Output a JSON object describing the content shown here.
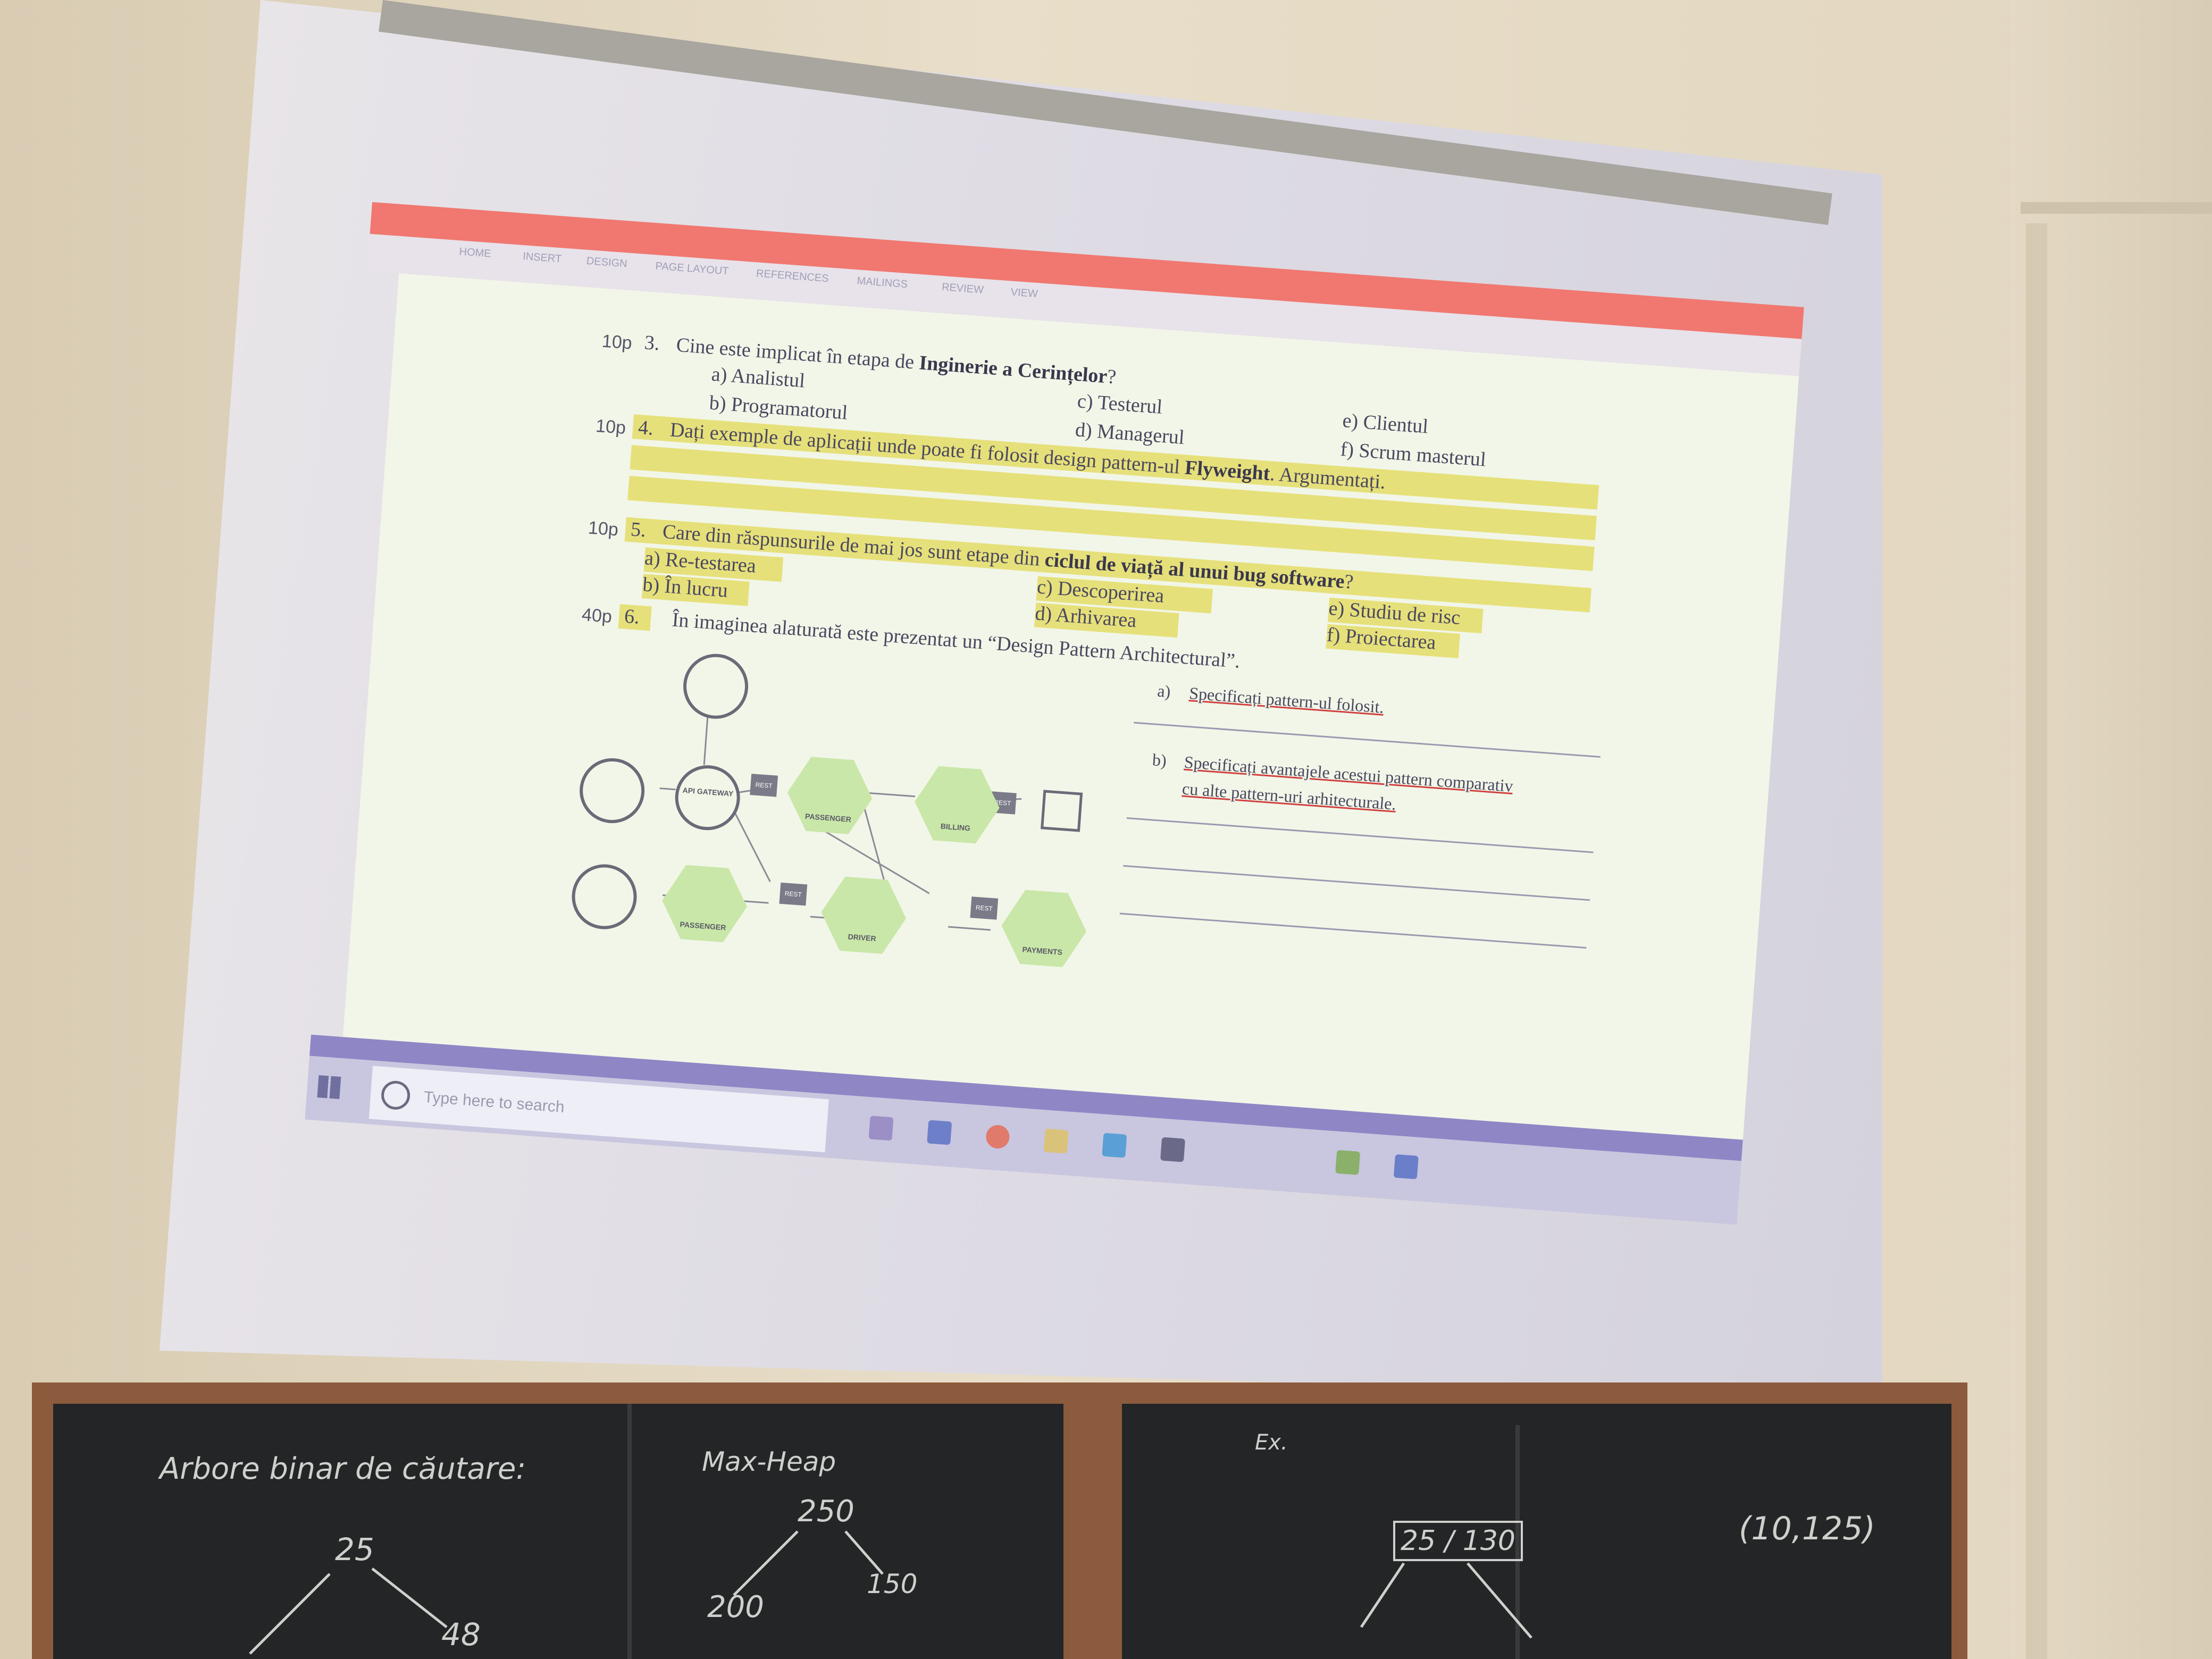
{
  "window": {
    "ribbon_tabs": [
      "HOME",
      "INSERT",
      "DESIGN",
      "PAGE LAYOUT",
      "REFERENCES",
      "MAILINGS",
      "REVIEW",
      "VIEW"
    ]
  },
  "document": {
    "q3": {
      "points": "10p",
      "number": "3.",
      "text_pre": "Cine este implicat în etapa de ",
      "text_bold": "Inginerie a Cerințelor",
      "text_post": "?",
      "options": [
        "a) Analistul",
        "b) Programatorul",
        "c) Testerul",
        "d) Managerul",
        "e) Clientul",
        "f) Scrum masterul"
      ]
    },
    "q4": {
      "points": "10p",
      "number": "4.",
      "text_pre": "Dați exemple de aplicații unde poate fi folosit design pattern-ul ",
      "text_bold": "Flyweight",
      "text_post": ". Argumentați."
    },
    "q5": {
      "points": "10p",
      "number": "5.",
      "text_pre": "Care din răspunsurile de mai jos sunt etape din ",
      "text_bold": "ciclul de viață al unui bug software",
      "text_post": "?",
      "options": [
        "a)  Re-testarea",
        "b)  În lucru",
        "c)  Descoperirea",
        "d)  Arhivarea",
        "e)  Studiu de risc",
        "f)  Proiectarea"
      ]
    },
    "q6": {
      "points": "40p",
      "number": "6.",
      "text": "În imaginea alaturată este prezentat un “Design Pattern Architectural”.",
      "sub_a_label": "a)",
      "sub_a": "Specificați pattern-ul folosit.",
      "sub_b_label": "b)",
      "sub_b_line1": "Specificați avantajele acestui pattern comparativ",
      "sub_b_line2": "cu alte pattern-uri arhitecturale."
    },
    "diagram": {
      "gateway_label": "API GATEWAY",
      "rest_label": "REST",
      "services": [
        "PASSENGER",
        "BILLING",
        "PASSENGER",
        "DRIVER",
        "PAYMENTS"
      ]
    }
  },
  "taskbar": {
    "search_placeholder": "Type here to search"
  },
  "blackboard": {
    "left_title": "Arbore binar de căutare:",
    "left_root": "25",
    "left_child": "48",
    "middle_title": "Max-Heap",
    "middle_root": "250",
    "middle_left": "200",
    "middle_right": "150",
    "right_top": "Ex.",
    "right_node": "25 / 130",
    "right_pair": "(10,125)"
  }
}
